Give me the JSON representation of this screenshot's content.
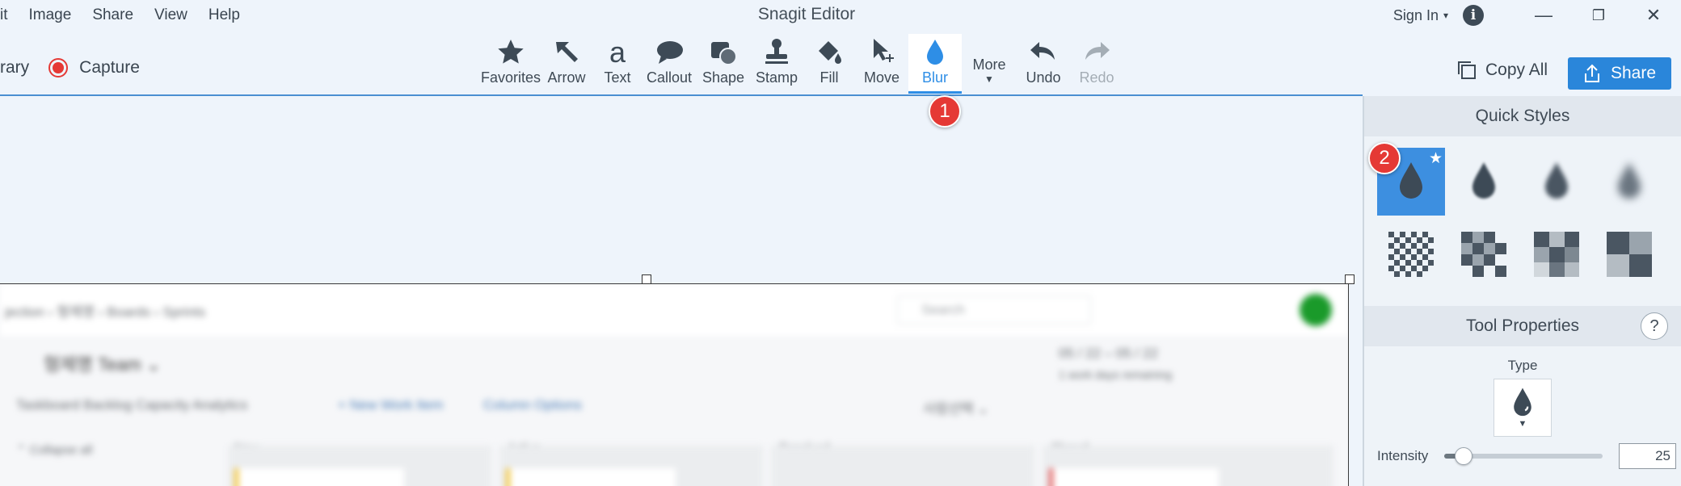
{
  "app": {
    "title": "Snagit Editor"
  },
  "menu": {
    "items": [
      "it",
      "Image",
      "Share",
      "View",
      "Help"
    ]
  },
  "window": {
    "sign_in": "Sign In",
    "sign_in_caret": "▾",
    "info_icon": "i",
    "minimize": "—",
    "restore": "❐",
    "close": "✕"
  },
  "toolbar": {
    "library_label": "rary",
    "capture_label": "Capture",
    "tools": [
      {
        "id": "favorites",
        "label": "Favorites",
        "icon": "star-icon"
      },
      {
        "id": "arrow",
        "label": "Arrow",
        "icon": "arrow-icon"
      },
      {
        "id": "text",
        "label": "Text",
        "icon": "text-icon"
      },
      {
        "id": "callout",
        "label": "Callout",
        "icon": "callout-icon"
      },
      {
        "id": "shape",
        "label": "Shape",
        "icon": "shape-icon"
      },
      {
        "id": "stamp",
        "label": "Stamp",
        "icon": "stamp-icon"
      },
      {
        "id": "fill",
        "label": "Fill",
        "icon": "fill-icon"
      },
      {
        "id": "move",
        "label": "Move",
        "icon": "move-icon"
      },
      {
        "id": "blur",
        "label": "Blur",
        "icon": "blur-drop-icon",
        "active": true
      },
      {
        "id": "more",
        "label": "More",
        "icon": "caret-down-icon"
      },
      {
        "id": "undo",
        "label": "Undo",
        "icon": "undo-icon"
      },
      {
        "id": "redo",
        "label": "Redo",
        "icon": "redo-icon",
        "disabled": true
      }
    ],
    "copy_all_label": "Copy All",
    "share_label": "Share",
    "accent_color": "#2a86da"
  },
  "annotations": {
    "badge1": "1",
    "badge2": "2"
  },
  "panel": {
    "quick_styles_title": "Quick Styles",
    "tool_properties_title": "Tool Properties",
    "help_label": "?",
    "type_label": "Type",
    "intensity_label": "Intensity",
    "intensity_value": "25",
    "intensity_fraction": 0.12,
    "star": "★"
  },
  "blurred_image": {
    "breadcrumb": "jection  ›  형제명  ›  Boards  ›  Sprints",
    "search_placeholder": "Search",
    "team": "형제명 Team ⌄",
    "sprint_dates": "05 / 22 – 05 / 22",
    "sprint_note": "1 work days remaining",
    "tabs": "Taskboard     Backlog     Capacity     Analytics",
    "new_item": "+  New Work Item",
    "column_options": "Column Options",
    "person_filter": "사람선택 ⌄",
    "collapse_all": "⌃ Collapse all",
    "columns": [
      "New",
      "Active",
      "Resolved",
      "Closed"
    ]
  }
}
